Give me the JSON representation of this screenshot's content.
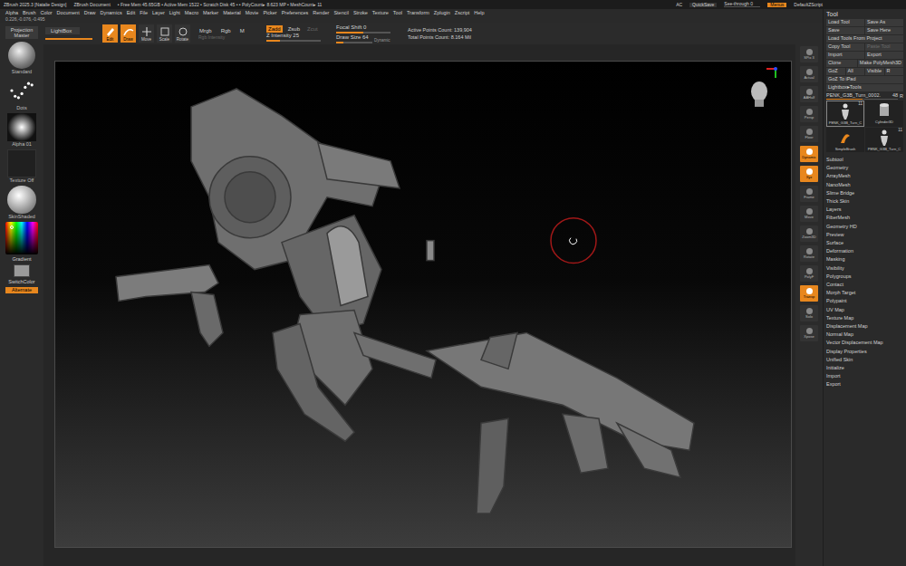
{
  "title_bar": {
    "items": [
      "ZBrush 2025.3 [Natalie Design]",
      "ZBrush Document",
      "• Free Mem 45.65GB • Active Mem 1522 • Scratch Disk 45 • • PolyCount▸ 8.623 MP • MeshCount▸ 11"
    ],
    "ac": "AC",
    "quicksave": "QuickSave",
    "see_through": {
      "label": "See-through 0",
      "level": 0
    },
    "menus": {
      "label": "Menus",
      "selected": true
    },
    "script": "DefaultZScript"
  },
  "menu_bar": [
    "Alpha",
    "Brush",
    "Color",
    "Document",
    "Draw",
    "Dynamics",
    "Edit",
    "File",
    "Layer",
    "Light",
    "Macro",
    "Marker",
    "Material",
    "Movie",
    "Picker",
    "Preferences",
    "Render",
    "Stencil",
    "Stroke",
    "Texture",
    "Tool",
    "Transform",
    "Zplugin",
    "Zscript",
    "Help"
  ],
  "coords": "0.226,-0.076,-0.495",
  "shelf": {
    "projection_master": "Projection Master",
    "lightbox": "LightBox",
    "modes": [
      {
        "label": "Edit",
        "selected": true
      },
      {
        "label": "Draw",
        "selected": true
      },
      {
        "label": "Move",
        "selected": false
      },
      {
        "label": "Scale",
        "selected": false
      },
      {
        "label": "Rotate",
        "selected": false
      }
    ],
    "color_modes": [
      {
        "label": "Mrgb",
        "selected": false
      },
      {
        "label": "Rgb",
        "selected": false
      },
      {
        "label": "M",
        "selected": false
      }
    ],
    "rgb_intensity": {
      "label": "Rgb Intensity",
      "disabled": true
    },
    "z_modes": [
      {
        "label": "Zadd",
        "selected": true,
        "disabled": false
      },
      {
        "label": "Zsub",
        "selected": false,
        "disabled": false
      },
      {
        "label": "Zcut",
        "selected": false,
        "disabled": true
      }
    ],
    "z_intensity": {
      "label": "Z Intensity 25",
      "level": 0.25
    },
    "focal_shift": {
      "label": "Focal Shift 0",
      "level": 0.5
    },
    "draw_size": {
      "label": "Draw Size 64",
      "level": 0.2
    },
    "dynamic": "Dynamic",
    "counts": [
      "Active Points Count: 139,904",
      "Total Points Count: 8.164 Mil"
    ]
  },
  "left_tray": {
    "items": [
      {
        "label": "Standard",
        "kind": "brush"
      },
      {
        "label": "Dots",
        "kind": "stroke"
      },
      {
        "label": "Alpha 01",
        "kind": "alpha"
      },
      {
        "label": "Texture Off",
        "kind": "texture"
      },
      {
        "label": "SkinShaded",
        "kind": "material"
      }
    ],
    "gradient": "Gradient",
    "switch_color": "SwitchColor",
    "alternate": {
      "label": "Alternate",
      "selected": true
    }
  },
  "right_shelf": [
    {
      "label": "SPix 3",
      "active": false
    },
    {
      "label": "Actual",
      "active": false
    },
    {
      "label": "AAHalf",
      "active": false
    },
    {
      "label": "Persp",
      "active": false
    },
    {
      "label": "Floor",
      "active": false
    },
    {
      "label": "Dynamic",
      "active": true
    },
    {
      "label": "Xyz",
      "active": true
    },
    {
      "label": "Frame",
      "active": false
    },
    {
      "label": "Move",
      "active": false
    },
    {
      "label": "Zoom3D",
      "active": false
    },
    {
      "label": "Rotate",
      "active": false
    },
    {
      "label": "PolyF",
      "active": false
    },
    {
      "label": "Transp",
      "active": true
    },
    {
      "label": "Solo",
      "active": false
    },
    {
      "label": "Xpose",
      "active": false
    }
  ],
  "tool_panel": {
    "title": "Tool",
    "button_rows": [
      [
        {
          "label": "Load Tool",
          "disabled": false
        },
        {
          "label": "Save As",
          "disabled": false
        }
      ],
      [
        {
          "label": "Save",
          "disabled": false
        },
        {
          "label": "Save Here",
          "disabled": false
        }
      ],
      [
        {
          "label": "Load Tools From Project",
          "disabled": false
        }
      ],
      [
        {
          "label": "Copy Tool",
          "disabled": false
        },
        {
          "label": "Paste Tool",
          "disabled": true
        }
      ],
      [
        {
          "label": "Import",
          "disabled": false
        },
        {
          "label": "Export",
          "disabled": false
        }
      ],
      [
        {
          "label": "Clone",
          "disabled": false
        },
        {
          "label": "Make PolyMesh3D",
          "disabled": false
        }
      ],
      [
        {
          "label": "GoZ",
          "disabled": false
        },
        {
          "label": "All",
          "disabled": false
        },
        {
          "label": "Visible",
          "disabled": false
        },
        {
          "label": "R",
          "disabled": false
        }
      ],
      [
        {
          "label": "GoZ To iPad",
          "disabled": false
        }
      ]
    ],
    "lightbox_tools": "Lightbox▸Tools",
    "current_tool": {
      "label": "PENK_G3B_Turn_0002.",
      "value": "48",
      "level": 0.5,
      "r": "R"
    },
    "thumbnails": [
      {
        "label": "PENK_G3B_Turn_C",
        "badge": "11",
        "kind": "figure"
      },
      {
        "label": "Cylinder3D",
        "badge": "",
        "kind": "cylinder"
      },
      {
        "label": "SimpleBrush",
        "badge": "",
        "kind": "brush"
      },
      {
        "label": "PENK_G3B_Turn_C",
        "badge": "11",
        "kind": "figure"
      }
    ],
    "sections": [
      "Subtool",
      "Geometry",
      "ArrayMesh",
      "NanoMesh",
      "Slime Bridge",
      "Thick Skin",
      "Layers",
      "FiberMesh",
      "Geometry HD",
      "Preview",
      "Surface",
      "Deformation",
      "Masking",
      "Visibility",
      "Polygroups",
      "Contact",
      "Morph Target",
      "Polypaint",
      "UV Map",
      "Texture Map",
      "Displacement Map",
      "Normal Map",
      "Vector Displacement Map",
      "Display Properties",
      "Unified Skin",
      "Initialize",
      "Import",
      "Export"
    ]
  }
}
